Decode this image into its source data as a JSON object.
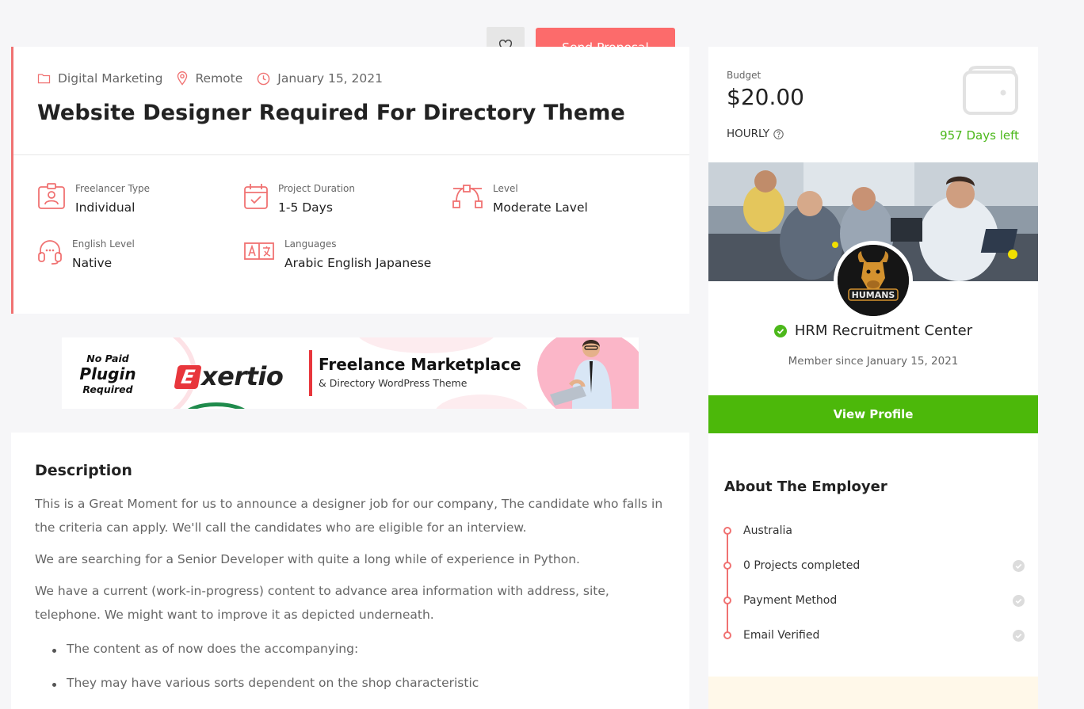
{
  "actions": {
    "favorite_icon": "heart-icon",
    "send_proposal_label": "Send Proposal"
  },
  "job": {
    "category": "Digital Marketing",
    "location": "Remote",
    "date": "January 15, 2021",
    "title": "Website Designer Required For Directory Theme",
    "attributes": [
      {
        "label": "Freelancer Type",
        "value": "Individual",
        "icon": "id-card-icon"
      },
      {
        "label": "Project Duration",
        "value": "1-5 Days",
        "icon": "calendar-check-icon"
      },
      {
        "label": "Level",
        "value": "Moderate Lavel",
        "icon": "vector-path-icon"
      },
      {
        "label": "English Level",
        "value": "Native",
        "icon": "headset-icon"
      },
      {
        "label": "Languages",
        "value": "Arabic English Japanese",
        "icon": "translate-icon"
      }
    ]
  },
  "banner": {
    "no_paid": "No Paid",
    "plugin": "Plugin",
    "required": "Required",
    "logo": "xertio",
    "logo_mark": "E",
    "headline": "Freelance Marketplace",
    "subline": "& Directory WordPress Theme"
  },
  "description": {
    "title": "Description",
    "paragraphs": [
      "This is a Great  Moment for us to announce a designer job for our company, The candidate who falls in the criteria can apply. We'll call the candidates who are eligible for an interview.",
      "We are searching for a Senior Developer with quite a long while of experience in Python.",
      "We have a current (work-in-progress) content to advance area information with address, site, telephone. We might want to improve it as depicted underneath."
    ],
    "bullets": [
      "The content as of now does the accompanying:",
      "They may have various sorts dependent on the shop characteristic"
    ]
  },
  "sidebar": {
    "budget_label": "Budget",
    "budget_amount": "$20.00",
    "rate_type": "HOURLY",
    "days_left": "957 Days left",
    "employer_name": "HRM Recruitment Center",
    "member_since": "Member since January 15, 2021",
    "view_profile_label": "View Profile",
    "about_title": "About The Employer",
    "about_items": [
      {
        "text": "Australia",
        "checked": false
      },
      {
        "text": "0 Projects completed",
        "checked": true
      },
      {
        "text": "Payment Method",
        "checked": true
      },
      {
        "text": "Email Verified",
        "checked": true
      }
    ],
    "avatar_text": "HUMANS"
  },
  "colors": {
    "accent": "#fc6b6b",
    "green": "#4cb80a",
    "text": "#222222",
    "muted": "#666666"
  }
}
